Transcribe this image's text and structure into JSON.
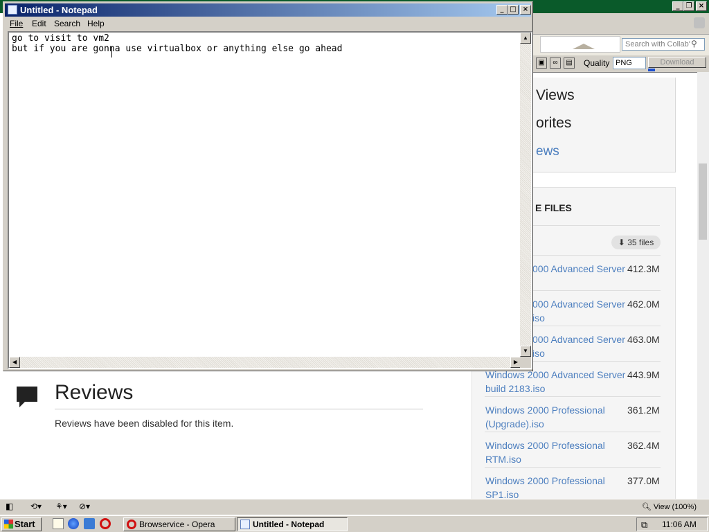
{
  "notepad": {
    "title": "Untitled - Notepad",
    "menu": [
      "File",
      "Edit",
      "Search",
      "Help"
    ],
    "lines": [
      "go to visit to vm2",
      "but if you are gonna use virtualbox or anything else go ahead"
    ]
  },
  "browser": {
    "search_placeholder": "Search with Collab'",
    "quality_label": "Quality",
    "quality_value": "PNG",
    "download_label": "Download",
    "sidebar_partial": [
      "Views",
      "orites",
      "ews"
    ],
    "files_heading_partial": "E FILES",
    "files_count": "35 files",
    "files": [
      {
        "name": "000 Advanced Server",
        "size": "412.3M"
      },
      {
        "name": "000 Advanced Server iso",
        "size": "462.0M"
      },
      {
        "name": "000 Advanced Server iso",
        "size": "463.0M"
      },
      {
        "name": "Windows 2000 Advanced Server build 2183.iso",
        "size": "443.9M"
      },
      {
        "name": "Windows 2000 Professional (Upgrade).iso",
        "size": "361.2M"
      },
      {
        "name": "Windows 2000 Professional RTM.iso",
        "size": "362.4M"
      },
      {
        "name": "Windows 2000 Professional SP1.iso",
        "size": "377.0M"
      }
    ],
    "reviews_title": "Reviews",
    "reviews_text": "Reviews have been disabled for this item.",
    "zoom": "View (100%)"
  },
  "taskbar": {
    "start_label": "Start",
    "tasks": [
      {
        "label": "Browservice - Opera"
      },
      {
        "label": "Untitled - Notepad"
      }
    ],
    "clock": "11:06 AM"
  },
  "colors": {
    "link": "#4d7fbf",
    "title_active": "#0a246a",
    "browser_title": "#0a5a2a"
  }
}
